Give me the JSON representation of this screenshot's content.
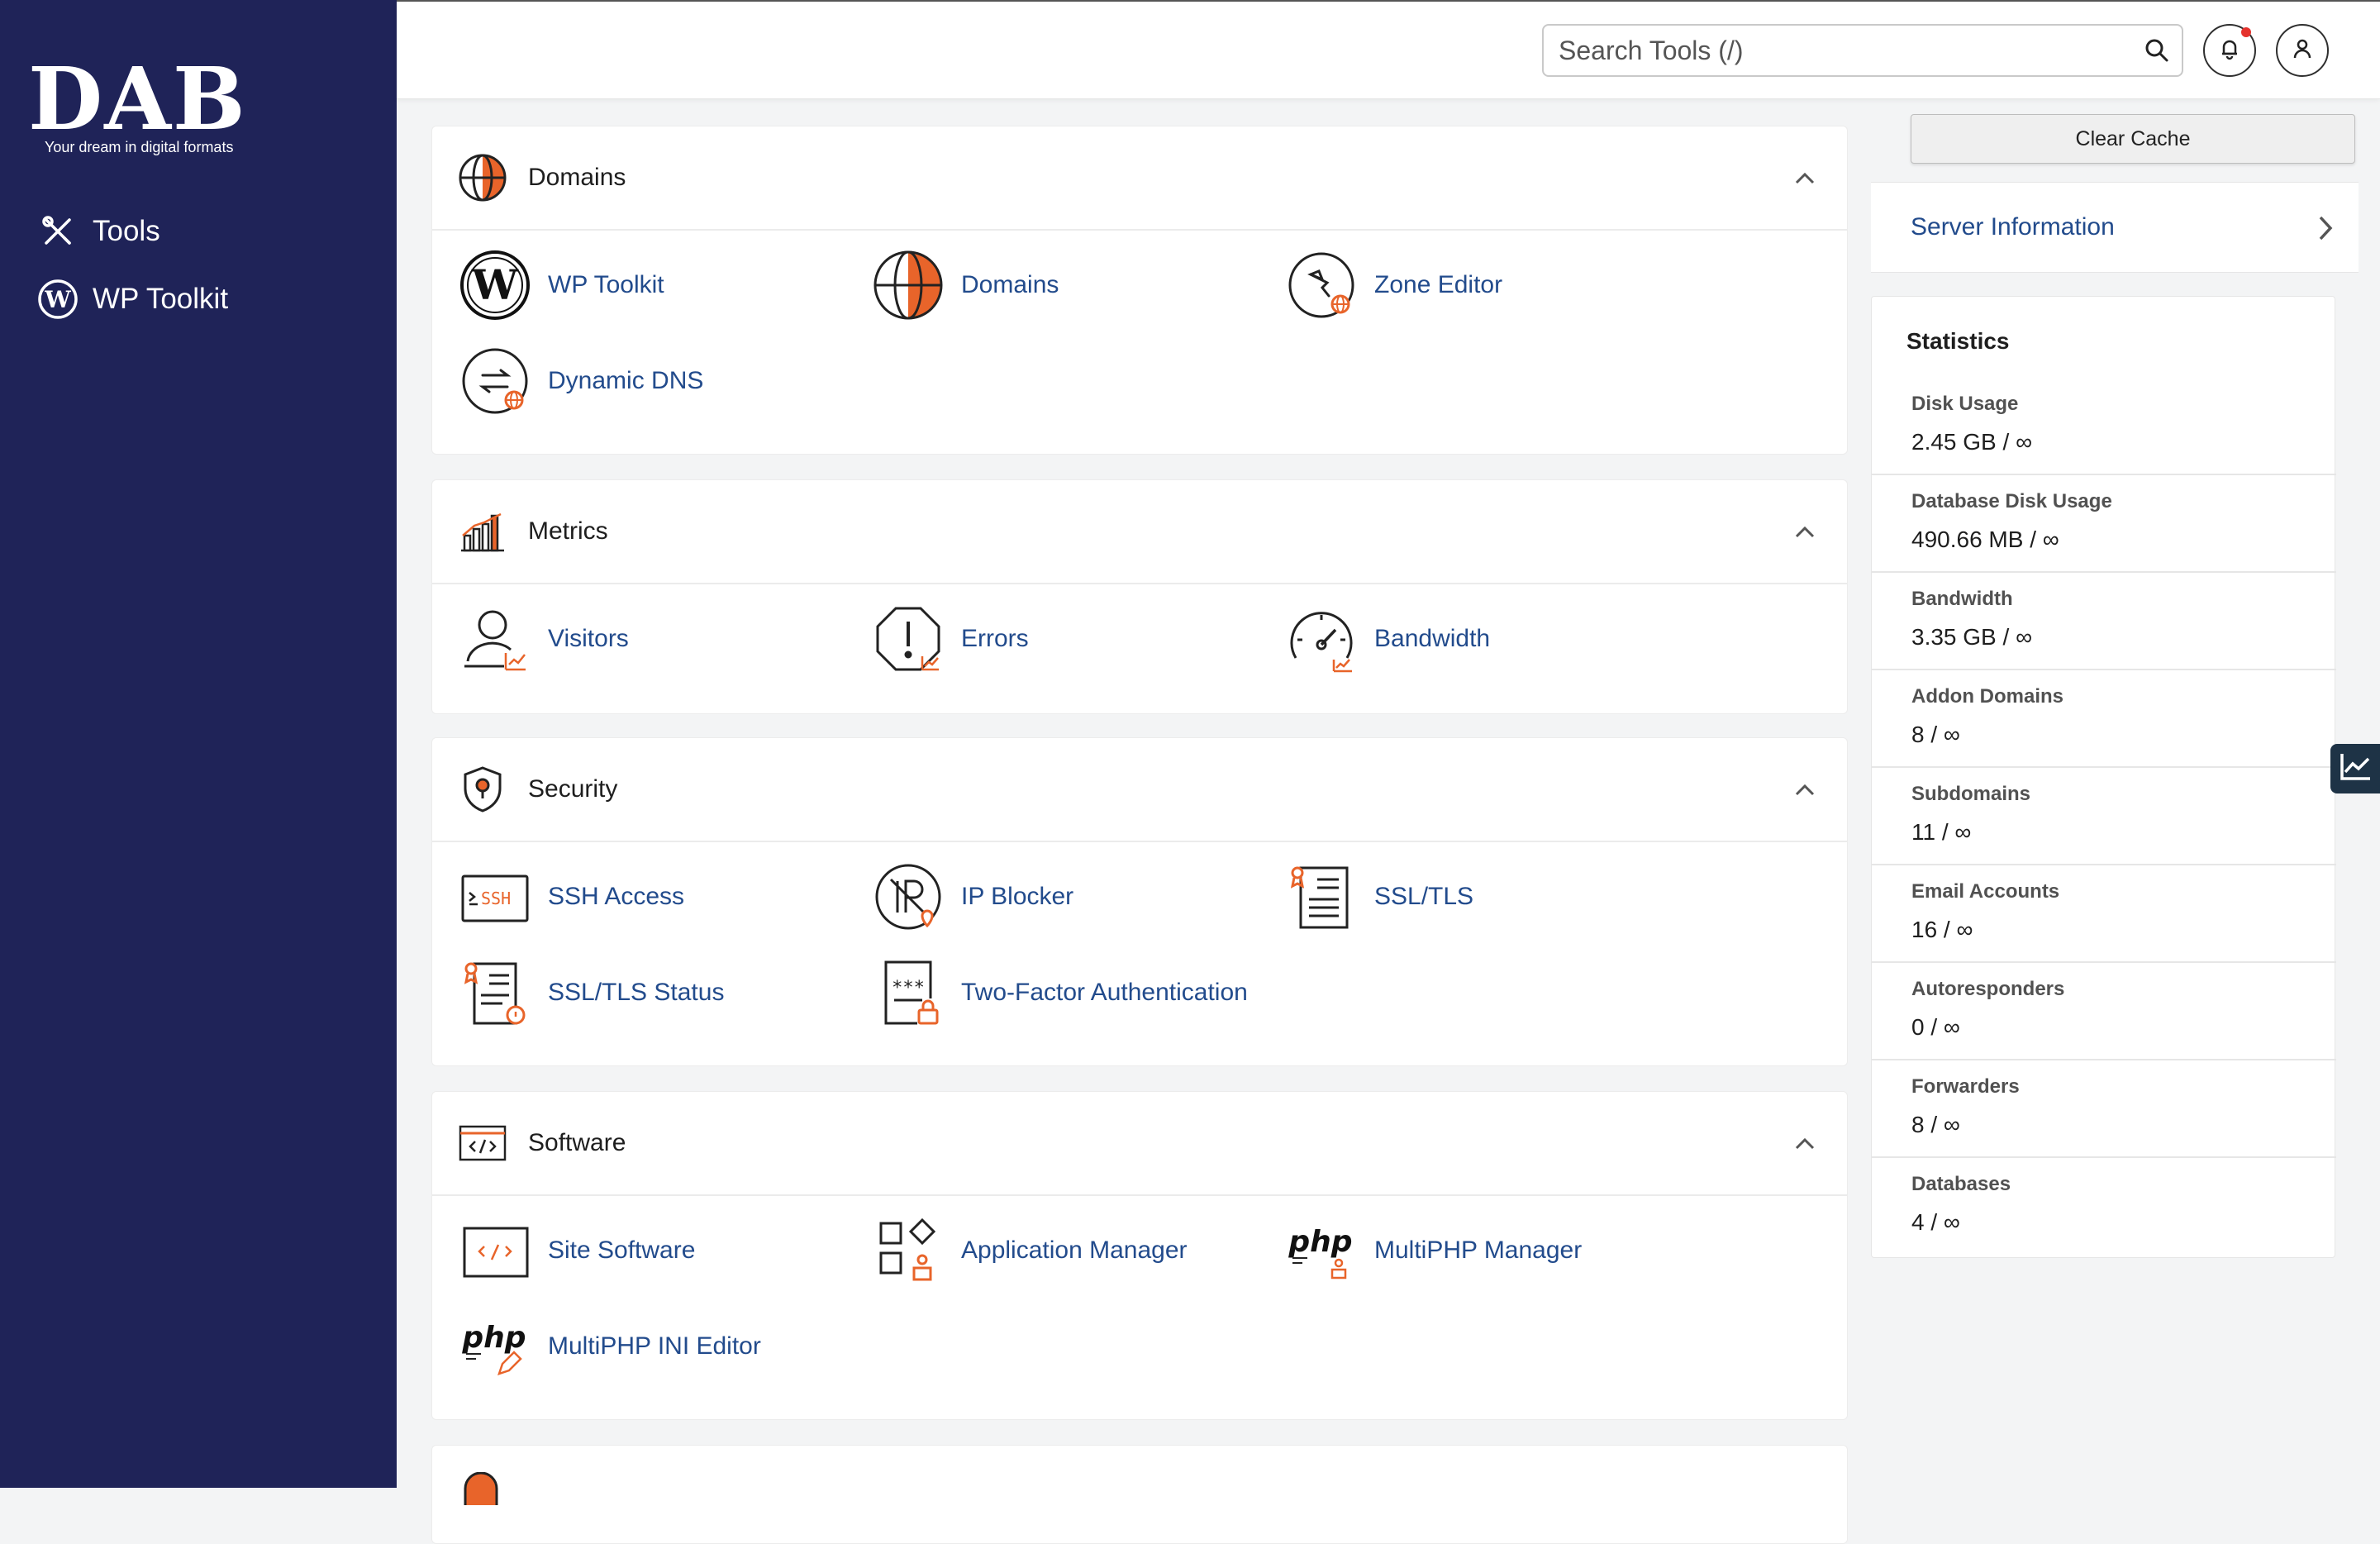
{
  "brand": {
    "logo_text": "DAB",
    "tagline": "Your dream in digital formats"
  },
  "sidebar": {
    "items": [
      {
        "label": "Tools",
        "icon": "tools-icon"
      },
      {
        "label": "WP Toolkit",
        "icon": "wordpress-icon"
      }
    ]
  },
  "topbar": {
    "search_placeholder": "Search Tools (/)",
    "notification_icon": "bell-icon",
    "user_icon": "user-icon"
  },
  "sections": [
    {
      "title": "Domains",
      "icon": "globe-icon",
      "tools": [
        {
          "label": "WP Toolkit",
          "icon": "wordpress-icon"
        },
        {
          "label": "Domains",
          "icon": "globe-icon"
        },
        {
          "label": "Zone Editor",
          "icon": "zone-editor-icon"
        },
        {
          "label": "Dynamic DNS",
          "icon": "dynamic-dns-icon"
        }
      ]
    },
    {
      "title": "Metrics",
      "icon": "bar-chart-icon",
      "tools": [
        {
          "label": "Visitors",
          "icon": "visitors-icon"
        },
        {
          "label": "Errors",
          "icon": "errors-icon"
        },
        {
          "label": "Bandwidth",
          "icon": "gauge-icon"
        }
      ]
    },
    {
      "title": "Security",
      "icon": "shield-icon",
      "tools": [
        {
          "label": "SSH Access",
          "icon": "ssh-icon"
        },
        {
          "label": "IP Blocker",
          "icon": "ip-blocker-icon"
        },
        {
          "label": "SSL/TLS",
          "icon": "certificate-icon"
        },
        {
          "label": "SSL/TLS Status",
          "icon": "certificate-status-icon"
        },
        {
          "label": "Two-Factor Authentication",
          "icon": "two-factor-icon"
        }
      ]
    },
    {
      "title": "Software",
      "icon": "code-window-icon",
      "tools": [
        {
          "label": "Site Software",
          "icon": "code-window-icon"
        },
        {
          "label": "Application Manager",
          "icon": "app-manager-icon"
        },
        {
          "label": "MultiPHP Manager",
          "icon": "php-icon"
        },
        {
          "label": "MultiPHP INI Editor",
          "icon": "php-editor-icon"
        }
      ]
    }
  ],
  "right_panel": {
    "clear_cache_label": "Clear Cache",
    "server_info_label": "Server Information",
    "statistics_title": "Statistics",
    "stats": [
      {
        "label": "Disk Usage",
        "value": "2.45 GB / ∞"
      },
      {
        "label": "Database Disk Usage",
        "value": "490.66 MB / ∞"
      },
      {
        "label": "Bandwidth",
        "value": "3.35 GB / ∞"
      },
      {
        "label": "Addon Domains",
        "value": "8 / ∞"
      },
      {
        "label": "Subdomains",
        "value": "11 / ∞"
      },
      {
        "label": "Email Accounts",
        "value": "16 / ∞"
      },
      {
        "label": "Autoresponders",
        "value": "0 / ∞"
      },
      {
        "label": "Forwarders",
        "value": "8 / ∞"
      },
      {
        "label": "Databases",
        "value": "4 / ∞"
      }
    ]
  },
  "colors": {
    "sidebar_bg": "#1f2358",
    "link_blue": "#224b8c",
    "accent_orange": "#e8642a"
  }
}
